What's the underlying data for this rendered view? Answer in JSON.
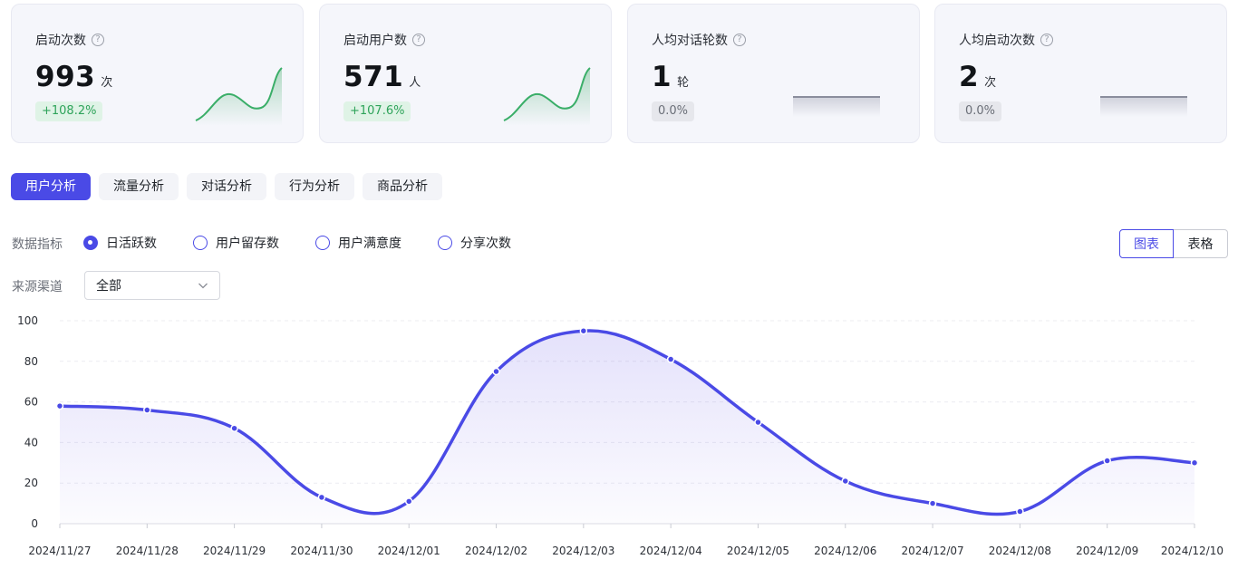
{
  "cards": [
    {
      "label": "启动次数",
      "value": "993",
      "unit": "次",
      "change": "+108.2%",
      "trend": "up"
    },
    {
      "label": "启动用户数",
      "value": "571",
      "unit": "人",
      "change": "+107.6%",
      "trend": "up"
    },
    {
      "label": "人均对话轮数",
      "value": "1",
      "unit": "轮",
      "change": "0.0%",
      "trend": "flat"
    },
    {
      "label": "人均启动次数",
      "value": "2",
      "unit": "次",
      "change": "0.0%",
      "trend": "flat"
    }
  ],
  "help_glyph": "?",
  "tabs": [
    "用户分析",
    "流量分析",
    "对话分析",
    "行为分析",
    "商品分析"
  ],
  "active_tab": 0,
  "indicator": {
    "label": "数据指标",
    "options": [
      "日活跃数",
      "用户留存数",
      "用户满意度",
      "分享次数"
    ],
    "selected": 0
  },
  "view_toggle": {
    "chart": "图表",
    "table": "表格"
  },
  "channel": {
    "label": "来源渠道",
    "value": "全部"
  },
  "colors": {
    "accent": "#4a4ae6",
    "up": "#2ea35a"
  },
  "chart_data": {
    "type": "area",
    "x": [
      "2024/11/27",
      "2024/11/28",
      "2024/11/29",
      "2024/11/30",
      "2024/12/01",
      "2024/12/02",
      "2024/12/03",
      "2024/12/04",
      "2024/12/05",
      "2024/12/06",
      "2024/12/07",
      "2024/12/08",
      "2024/12/09",
      "2024/12/10"
    ],
    "series": [
      {
        "values": [
          58,
          56,
          47,
          13,
          11,
          75,
          95,
          81,
          50,
          21,
          10,
          6,
          31,
          30
        ]
      }
    ],
    "ylim": [
      0,
      100
    ],
    "yticks": [
      0,
      20,
      40,
      60,
      80,
      100
    ],
    "grid": true,
    "legend": "none"
  }
}
